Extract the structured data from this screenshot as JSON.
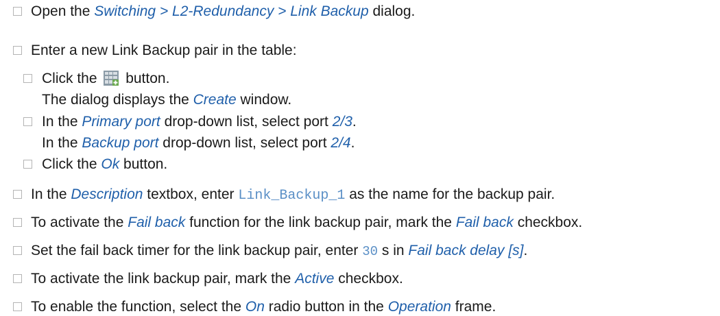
{
  "steps": [
    {
      "pre": "Open the ",
      "emph": "Switching > L2-Redundancy > Link Backup",
      "post": " dialog."
    },
    {
      "text": "Enter a new Link Backup pair in the table:"
    },
    {
      "pre": "Click the ",
      "post": " button.",
      "icon": "add-table-row-icon"
    },
    {
      "pre": "The dialog displays the ",
      "emph": "Create",
      "post": " window."
    },
    {
      "pre": "In the ",
      "emph": "Primary port",
      "mid": " drop-down list, select port ",
      "emph2": "2/3",
      "post": "."
    },
    {
      "pre": "In the ",
      "emph": "Backup port",
      "mid": " drop-down list, select port ",
      "emph2": "2/4",
      "post": "."
    },
    {
      "pre": "Click the ",
      "emph": "Ok",
      "post": " button."
    },
    {
      "pre": "In the ",
      "emph": "Description",
      "mid": " textbox, enter ",
      "code": "Link_Backup_1",
      "post": " as the name for the backup pair."
    },
    {
      "pre": "To activate the ",
      "emph": "Fail back",
      "mid": " function for the link backup pair, mark the ",
      "emph2": "Fail back",
      "post": " checkbox."
    },
    {
      "pre": "Set the fail back timer for the link backup pair, enter ",
      "code": "30",
      "mid": " s in ",
      "emph": "Fail back delay [s]",
      "post": "."
    },
    {
      "pre": "To activate the link backup pair, mark the ",
      "emph": "Active",
      "post": " checkbox."
    },
    {
      "pre": "To enable the function, select the ",
      "emph": "On",
      "mid": " radio button in the ",
      "emph2": "Operation",
      "post": " frame."
    }
  ],
  "colors": {
    "emphasis": "#1f5faa",
    "code": "#5a8fc6",
    "checkbox_border": "#b4b4b4"
  }
}
